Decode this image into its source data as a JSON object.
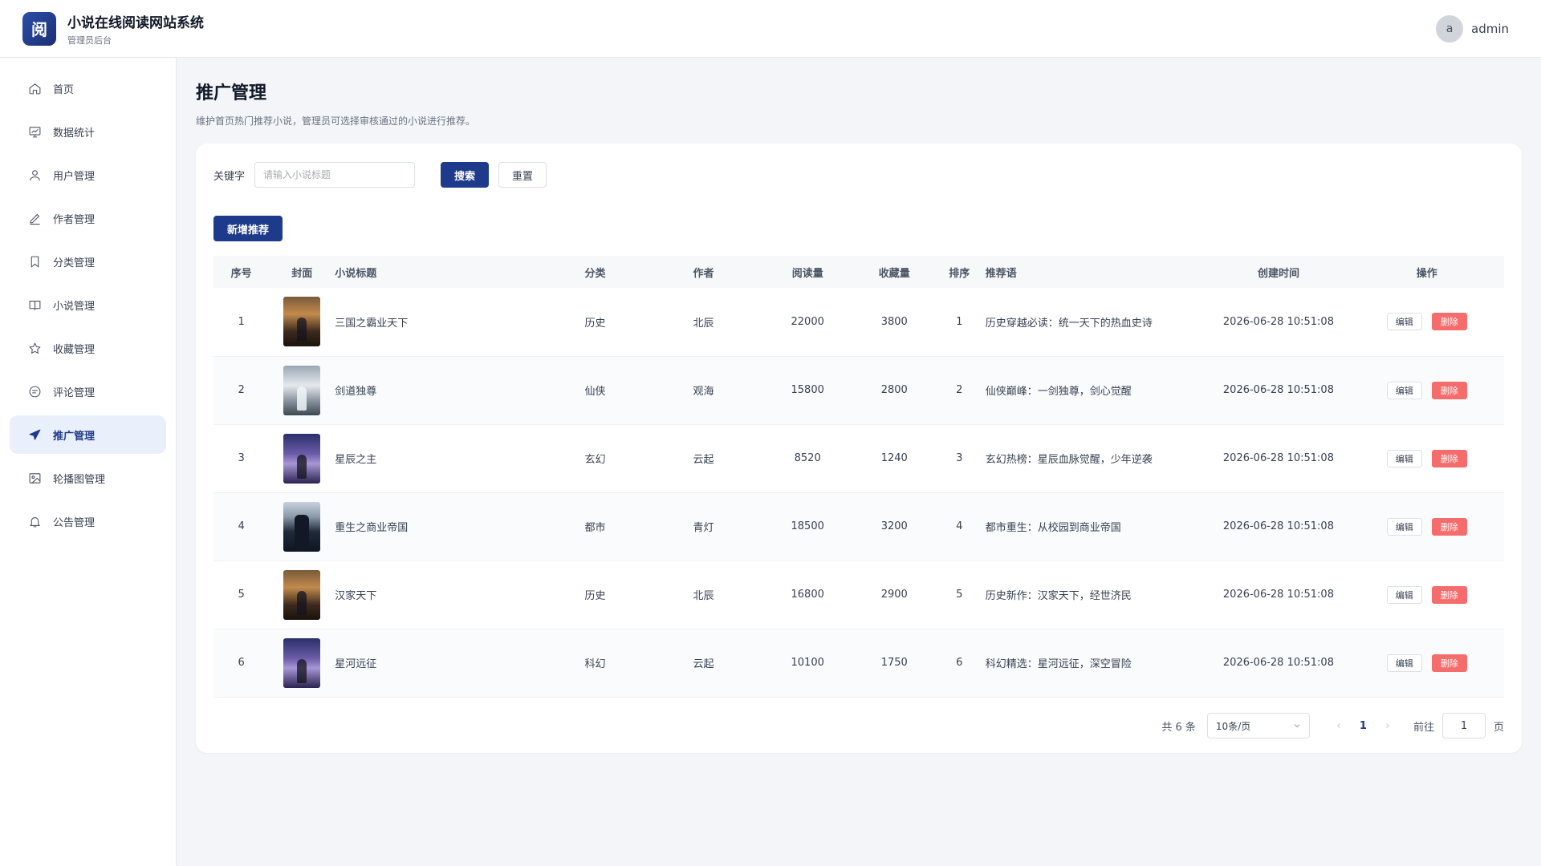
{
  "app": {
    "logo_text": "阅",
    "title": "小说在线阅读网站系统",
    "subtitle": "管理员后台"
  },
  "user": {
    "avatar_letter": "a",
    "name": "admin"
  },
  "sidebar": {
    "items": [
      {
        "label": "首页",
        "icon": "home-icon",
        "active": false
      },
      {
        "label": "数据统计",
        "icon": "chart-icon",
        "active": false
      },
      {
        "label": "用户管理",
        "icon": "user-icon",
        "active": false
      },
      {
        "label": "作者管理",
        "icon": "pen-icon",
        "active": false
      },
      {
        "label": "分类管理",
        "icon": "bookmark-icon",
        "active": false
      },
      {
        "label": "小说管理",
        "icon": "book-icon",
        "active": false
      },
      {
        "label": "收藏管理",
        "icon": "star-icon",
        "active": false
      },
      {
        "label": "评论管理",
        "icon": "comment-icon",
        "active": false
      },
      {
        "label": "推广管理",
        "icon": "send-icon",
        "active": true
      },
      {
        "label": "轮播图管理",
        "icon": "image-icon",
        "active": false
      },
      {
        "label": "公告管理",
        "icon": "bell-icon",
        "active": false
      }
    ]
  },
  "page": {
    "title": "推广管理",
    "description": "维护首页热门推荐小说，管理员可选择审核通过的小说进行推荐。"
  },
  "filter": {
    "label": "关键字",
    "placeholder": "请输入小说标题",
    "search_label": "搜索",
    "reset_label": "重置"
  },
  "add_label": "新增推荐",
  "table": {
    "headers": [
      "序号",
      "封面",
      "小说标题",
      "分类",
      "作者",
      "阅读量",
      "收藏量",
      "排序",
      "推荐语",
      "创建时间",
      "操作"
    ],
    "edit_label": "编辑",
    "delete_label": "删除",
    "rows": [
      {
        "index": "1",
        "cover": "history",
        "title": "三国之霸业天下",
        "category": "历史",
        "author": "北辰",
        "reads": "22000",
        "favorites": "3800",
        "sort": "1",
        "slogan": "历史穿越必读：统一天下的热血史诗",
        "created": "2026-06-28 10:51:08"
      },
      {
        "index": "2",
        "cover": "xianxia",
        "title": "剑道独尊",
        "category": "仙侠",
        "author": "观海",
        "reads": "15800",
        "favorites": "2800",
        "sort": "2",
        "slogan": "仙侠巅峰：一剑独尊，剑心觉醒",
        "created": "2026-06-28 10:51:08"
      },
      {
        "index": "3",
        "cover": "fantasy",
        "title": "星辰之主",
        "category": "玄幻",
        "author": "云起",
        "reads": "8520",
        "favorites": "1240",
        "sort": "3",
        "slogan": "玄幻热榜：星辰血脉觉醒，少年逆袭",
        "created": "2026-06-28 10:51:08"
      },
      {
        "index": "4",
        "cover": "city",
        "title": "重生之商业帝国",
        "category": "都市",
        "author": "青灯",
        "reads": "18500",
        "favorites": "3200",
        "sort": "4",
        "slogan": "都市重生：从校园到商业帝国",
        "created": "2026-06-28 10:51:08"
      },
      {
        "index": "5",
        "cover": "history",
        "title": "汉家天下",
        "category": "历史",
        "author": "北辰",
        "reads": "16800",
        "favorites": "2900",
        "sort": "5",
        "slogan": "历史新作：汉家天下，经世济民",
        "created": "2026-06-28 10:51:08"
      },
      {
        "index": "6",
        "cover": "fantasy",
        "title": "星河远征",
        "category": "科幻",
        "author": "云起",
        "reads": "10100",
        "favorites": "1750",
        "sort": "6",
        "slogan": "科幻精选：星河远征，深空冒险",
        "created": "2026-06-28 10:51:08"
      }
    ]
  },
  "pagination": {
    "total_text": "共 6 条",
    "page_size": "10条/页",
    "current_page": "1",
    "goto_prefix": "前往",
    "goto_value": "1",
    "goto_suffix": "页"
  },
  "colors": {
    "primary": "#1e3a8a",
    "danger": "#f56c6c",
    "active_bg": "#eaf0fb"
  }
}
